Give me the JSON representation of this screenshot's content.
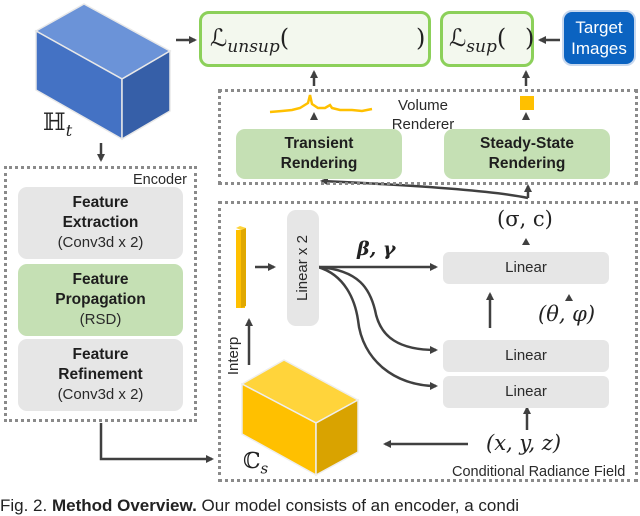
{
  "figure": {
    "inputs": {
      "hidden_volume_label": "ℍ",
      "hidden_volume_subscript": "t",
      "conditional_volume_label": "ℂ",
      "conditional_volume_subscript": "s"
    },
    "losses": {
      "unsup_symbol": "ℒ",
      "unsup_subscript": "unsup",
      "sup_symbol": "ℒ",
      "sup_subscript": "sup",
      "open_paren": "(",
      "close_paren": ")"
    },
    "target_images": {
      "label_line1": "Target",
      "label_line2": "Images"
    },
    "volume_renderer": {
      "title_line1": "Volume",
      "title_line2": "Renderer",
      "transient": {
        "line1": "Transient",
        "line2": "Rendering"
      },
      "steady_state": {
        "line1": "Steady-State",
        "line2": "Rendering"
      }
    },
    "encoder": {
      "title": "Encoder",
      "blocks": [
        {
          "line1": "Feature",
          "line2": "Extraction",
          "sub": "(Conv3d x 2)"
        },
        {
          "line1": "Feature",
          "line2": "Propagation",
          "sub": "(RSD)"
        },
        {
          "line1": "Feature",
          "line2": "Refinement",
          "sub": "(Conv3d x 2)"
        }
      ]
    },
    "crf": {
      "title": "Conditional Radiance Field",
      "linear_x2": "Linear x 2",
      "interp": "Interp",
      "film_params": "β, γ",
      "output": "(σ, c)",
      "view_dir": "(θ, φ)",
      "position": "(x, y, z)",
      "linear_blocks": [
        "Linear",
        "Linear",
        "Linear"
      ]
    },
    "colors": {
      "blue_cube_front": "#4472c4",
      "blue_cube_top": "#6b93d8",
      "blue_cube_side": "#365fa8",
      "yellow_cube_front": "#ffc000",
      "yellow_cube_top": "#ffd43b",
      "yellow_cube_side": "#d9a300",
      "loss_border": "#8cd05a",
      "target_blue": "#0b63c1",
      "signal_blue": "#2a7fd4",
      "signal_yellow": "#ffc000",
      "arrow": "#404040"
    }
  },
  "caption": {
    "prefix": "Fig. 2. ",
    "bold": "Method Overview.",
    "text": " Our model consists of an encoder, a condi"
  }
}
